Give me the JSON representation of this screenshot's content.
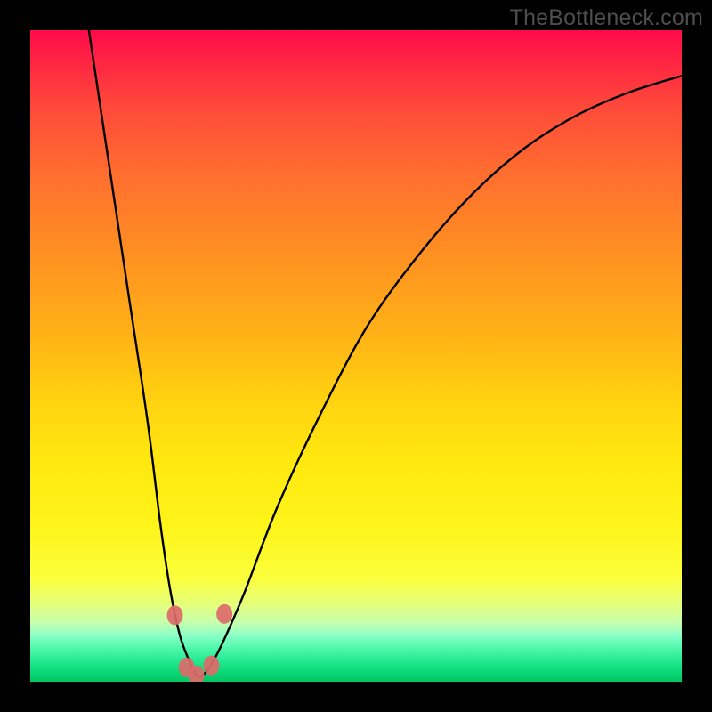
{
  "watermark": "TheBottleneck.com",
  "chart_data": {
    "type": "line",
    "title": "",
    "xlabel": "",
    "ylabel": "",
    "xlim": [
      0,
      100
    ],
    "ylim": [
      0,
      100
    ],
    "series": [
      {
        "name": "curve",
        "x": [
          9,
          12,
          15,
          18,
          20,
          21.5,
          23,
          24.5,
          25.5,
          26.5,
          28,
          30,
          33,
          38,
          45,
          52,
          60,
          68,
          76,
          84,
          92,
          100
        ],
        "values": [
          100,
          80,
          60,
          40,
          24,
          14,
          7,
          3,
          1,
          1,
          3,
          7,
          14,
          27,
          42,
          55,
          66,
          75,
          82,
          87,
          90.5,
          93
        ]
      }
    ],
    "markers": {
      "name": "highlight-dots",
      "color": "#dd6a6a",
      "x": [
        22.2,
        24.0,
        25.5,
        27.8,
        29.8
      ],
      "values": [
        10.2,
        2.2,
        1.0,
        2.5,
        10.4
      ]
    }
  }
}
